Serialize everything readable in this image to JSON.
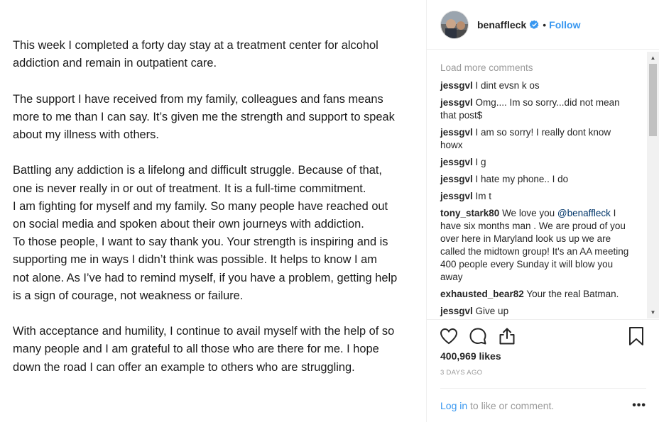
{
  "post_text": {
    "paragraphs": [
      "This week I completed a forty day stay at a treatment center for alcohol\naddiction and remain in outpatient care.",
      "The support I have received from my family, colleagues and fans means\nmore to me than I can say.  It’s given me the strength and support to speak\nabout my illness with others.",
      "Battling any addiction is a lifelong and difficult struggle. Because of that,\none is never really in or out of treatment. It is a full-time commitment.\nI am fighting for myself and my family. So many people have reached out\non social media and spoken about their own journeys with addiction.\nTo those people, I want to say thank you.  Your strength is inspiring and is\nsupporting me in ways I didn’t think was possible. It helps to know I am\nnot alone. As I’ve had to remind myself, if you have a problem, getting help\nis a sign of courage, not weakness or failure.",
      "With acceptance and humility, I continue to avail myself with the help of so\nmany people and I am grateful to all those who are there for me. I hope\ndown the road I can offer an example to others who are struggling."
    ]
  },
  "header": {
    "username": "benaffleck",
    "dot": "•",
    "follow_label": "Follow",
    "verified_icon": "verified-badge-icon"
  },
  "comments": {
    "load_more": "Load more comments",
    "items": [
      {
        "user": "jessgvl",
        "text": "I dint evsn k os"
      },
      {
        "user": "jessgvl",
        "text": "Omg.... Im so sorry...did not mean that post$"
      },
      {
        "user": "jessgvl",
        "text": "I am so sorry! I really dont know howx"
      },
      {
        "user": "jessgvl",
        "text": "I g"
      },
      {
        "user": "jessgvl",
        "text": "I hate my phone.. I do"
      },
      {
        "user": "jessgvl",
        "text": "Im t"
      },
      {
        "user": "tony_stark80",
        "text_before": "We love you ",
        "mention": "@benaffleck",
        "text_after": " I have six months man . We are proud of you over here in Maryland look us up we are called the midtown group! It's an AA meeting 400 people every Sunday it will blow you away"
      },
      {
        "user": "exhausted_bear82",
        "text": "Your the real Batman."
      },
      {
        "user": "jessgvl",
        "text": "Give up"
      }
    ]
  },
  "actions": {
    "icons": [
      "heart-icon",
      "comment-icon",
      "share-icon",
      "bookmark-icon"
    ],
    "likes": "400,969 likes",
    "time": "3 DAYS AGO",
    "login_link": "Log in",
    "login_rest": " to like or comment.",
    "more": "•••"
  },
  "colors": {
    "accent": "#3897f0",
    "muted": "#999999",
    "text": "#262626"
  }
}
